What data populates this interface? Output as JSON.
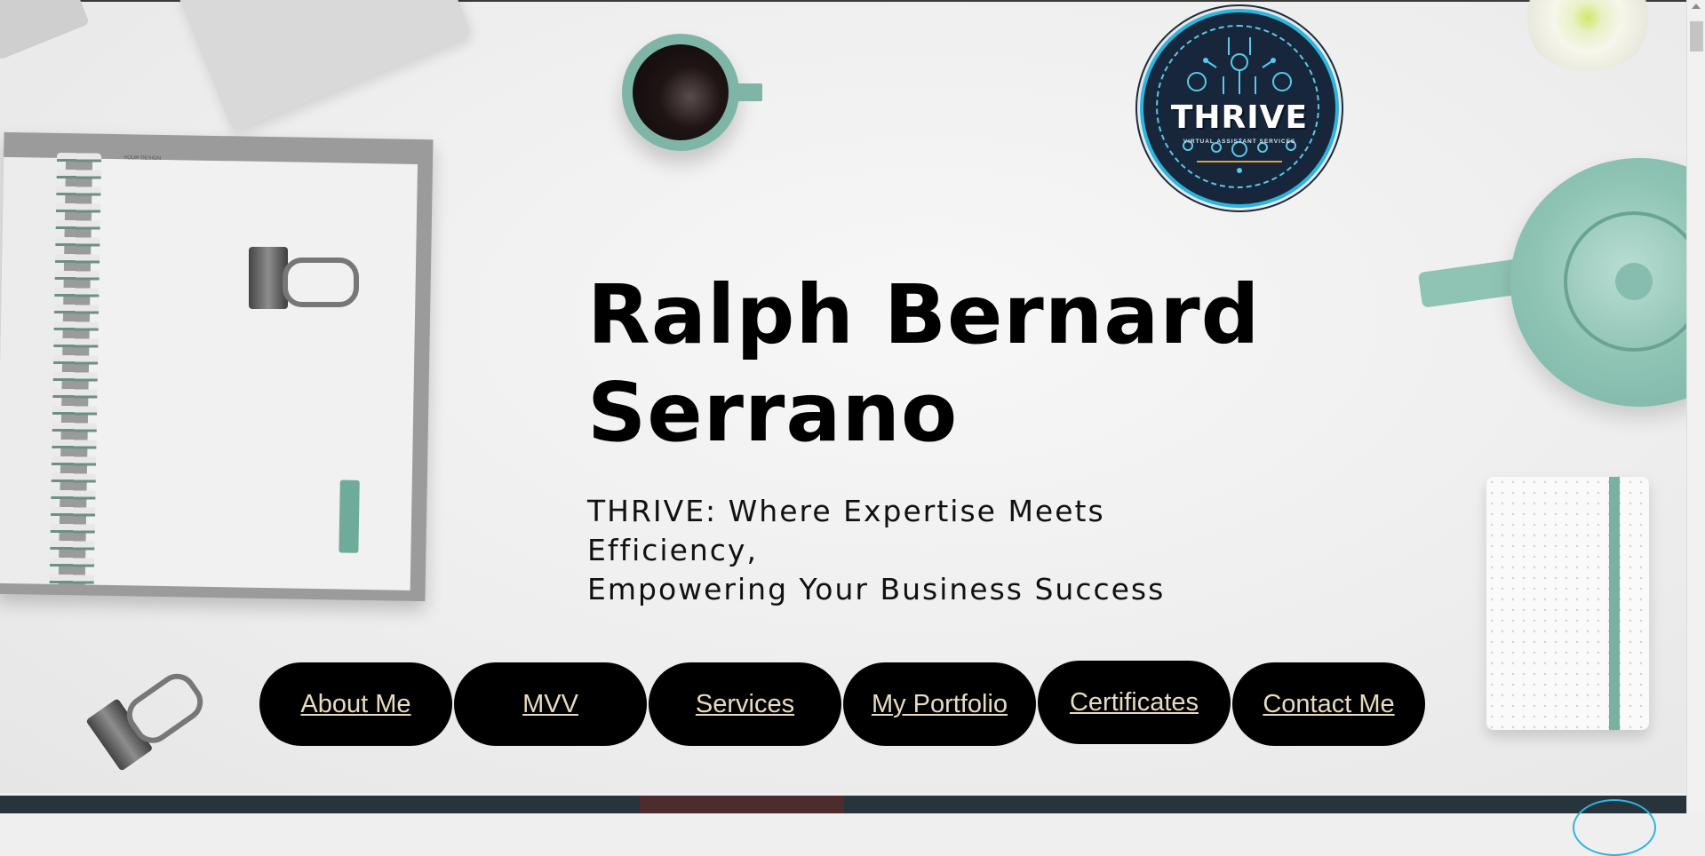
{
  "brand": {
    "logo_title": "THRIVE",
    "logo_subtitle": "VIRTUAL ASSISTANT SERVICES"
  },
  "hero": {
    "name_line1": "Ralph Bernard",
    "name_line2": "Serrano",
    "tagline_line1": "THRIVE: Where Expertise Meets Efficiency,",
    "tagline_line2": "Empowering Your Business Success",
    "notebook_text": "YOUR DESIGN"
  },
  "nav": {
    "items": [
      {
        "label": "About Me"
      },
      {
        "label": "MVV"
      },
      {
        "label": "Services"
      },
      {
        "label": "My Portfolio"
      },
      {
        "label": "Certificates"
      },
      {
        "label": "Contact Me"
      }
    ]
  },
  "colors": {
    "pill_bg": "#000000",
    "pill_text": "#e7dbc0",
    "accent_teal": "#79b1a3",
    "logo_bg": "#17263a",
    "logo_accent": "#2bb6e0"
  }
}
